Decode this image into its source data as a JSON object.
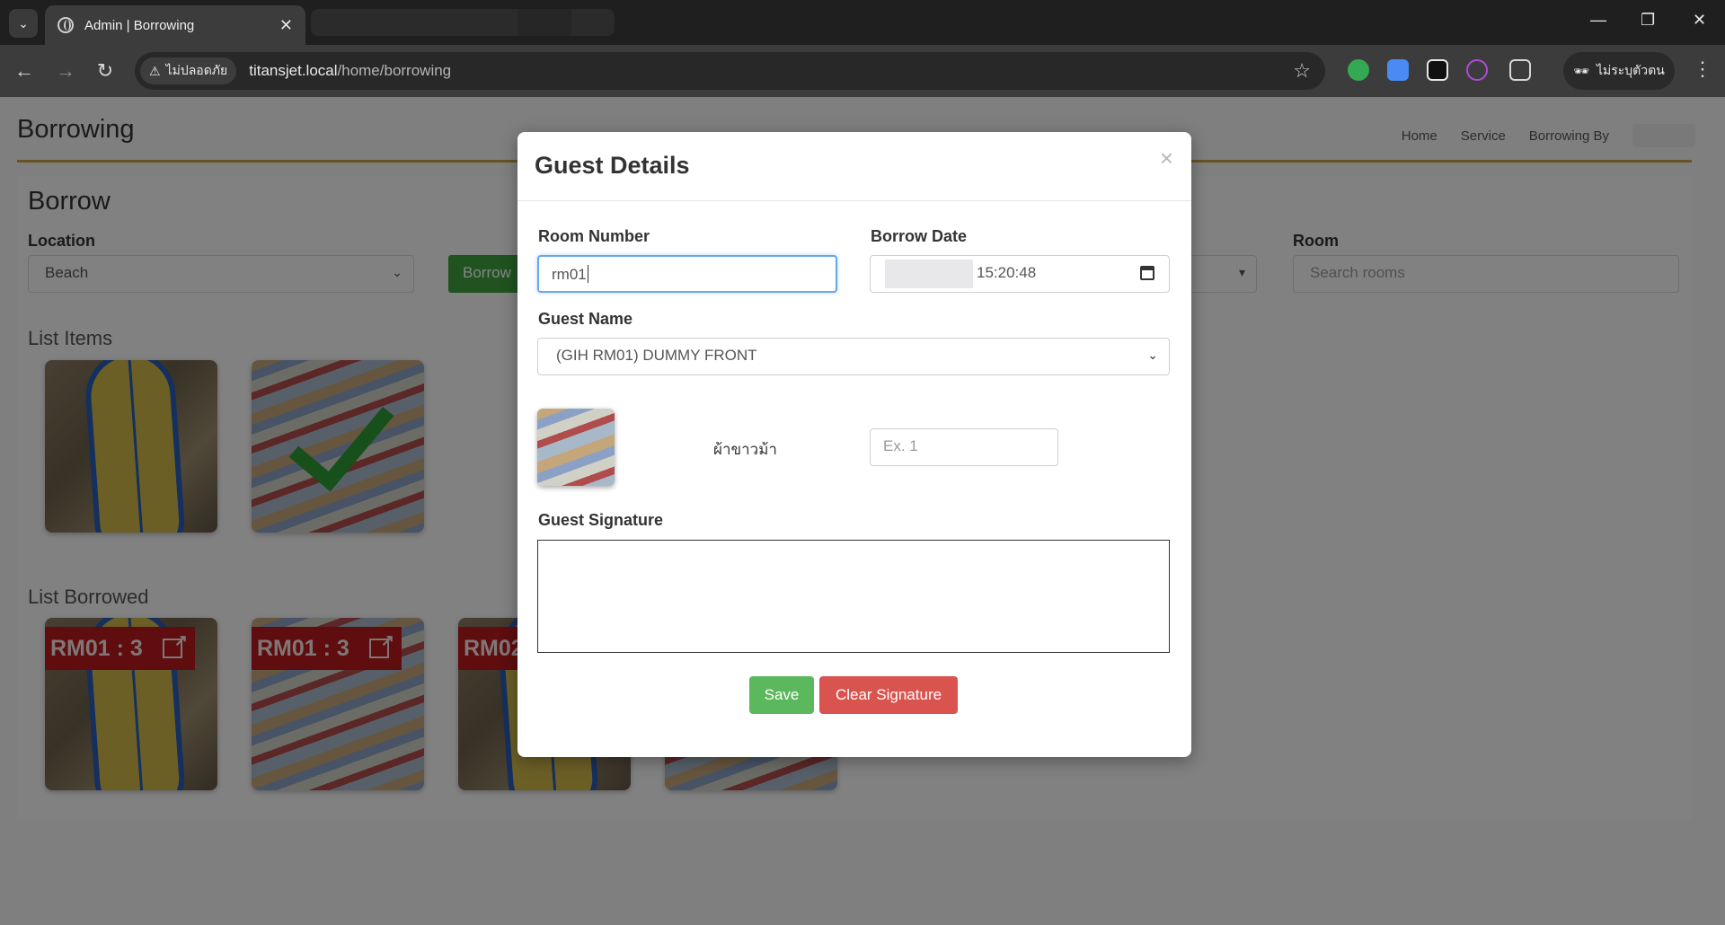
{
  "browser": {
    "tab_title": "Admin | Borrowing",
    "security_label": "ไม่ปลอดภัย",
    "url_host": "titansjet.local",
    "url_path": "/home/borrowing",
    "profile_label": "ไม่ระบุตัวตน",
    "extension_colors": [
      "#35a853",
      "#4a8af4",
      "#e8e8e8",
      "#b04ad6"
    ]
  },
  "page": {
    "title": "Borrowing",
    "breadcrumb": [
      "Home",
      "Service",
      "Borrowing By"
    ],
    "accent_color": "#c9a04a"
  },
  "borrow": {
    "heading": "Borrow",
    "location_label": "Location",
    "location_value": "Beach",
    "borrow_button": "Borrow",
    "room_label": "Room",
    "room_placeholder": "Search rooms",
    "list_items_heading": "List Items",
    "list_borrowed_heading": "List Borrowed",
    "borrowed_badges": [
      "RM01 : 3",
      "RM01 : 3",
      "RM02"
    ]
  },
  "modal": {
    "title": "Guest Details",
    "close_glyph": "×",
    "room_number_label": "Room Number",
    "room_number_value": "rm01",
    "borrow_date_label": "Borrow Date",
    "borrow_time_value": "15:20:48",
    "guest_name_label": "Guest Name",
    "guest_name_value": "(GIH RM01) DUMMY FRONT",
    "item_name": "ผ้าขาวม้า",
    "quantity_placeholder": "Ex. 1",
    "signature_label": "Guest Signature",
    "save_label": "Save",
    "clear_label": "Clear Signature"
  }
}
